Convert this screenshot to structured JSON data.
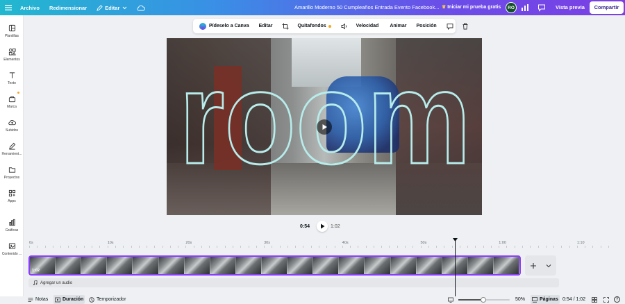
{
  "topbar": {
    "archivo": "Archivo",
    "redimensionar": "Redimensionar",
    "editar": "Editar",
    "doc_title": "Amarillo Moderno 50 Cumpleaños Entrada Evento Facebook...",
    "trial": "Iniciar mi prueba gratis",
    "avatar": "RO",
    "preview": "Vista previa",
    "share": "Compartir"
  },
  "sidebar": {
    "items": [
      {
        "label": "Plantillas",
        "icon": "template-icon"
      },
      {
        "label": "Elementos",
        "icon": "shapes-icon"
      },
      {
        "label": "Texto",
        "icon": "text-icon"
      },
      {
        "label": "Marca",
        "icon": "brand-icon"
      },
      {
        "label": "Subidos",
        "icon": "cloud-upload-icon"
      },
      {
        "label": "Herramient...",
        "icon": "pen-tool-icon"
      },
      {
        "label": "Proyectos",
        "icon": "folder-icon"
      },
      {
        "label": "Apps",
        "icon": "apps-icon"
      },
      {
        "label": "Gráficas",
        "icon": "chart-icon"
      },
      {
        "label": "Contenido ...",
        "icon": "image-icon"
      }
    ]
  },
  "toolbar": {
    "pideselo": "Pídeselo a Canva",
    "editar": "Editar",
    "quitafondos": "Quitafondos",
    "velocidad": "Velocidad",
    "animar": "Animar",
    "posicion": "Posición"
  },
  "canvas": {
    "overlay_text": "room"
  },
  "playback": {
    "current": "0:54",
    "total": "1:02"
  },
  "timeline": {
    "ticks": [
      "0s",
      "10s",
      "20s",
      "30s",
      "40s",
      "50s",
      "1:00",
      "1:10"
    ],
    "clip_duration": "1:02",
    "audio_label": "Agregar un audio",
    "frame_count": 19
  },
  "bottombar": {
    "notas": "Notas",
    "duracion": "Duración",
    "temporizador": "Temporizador",
    "zoom": "50%",
    "paginas": "Páginas",
    "page_time": "0:54 / 1:02",
    "help": "?"
  },
  "colors": {
    "accent": "#8b3dff",
    "share_text": "#3c2a8f"
  }
}
